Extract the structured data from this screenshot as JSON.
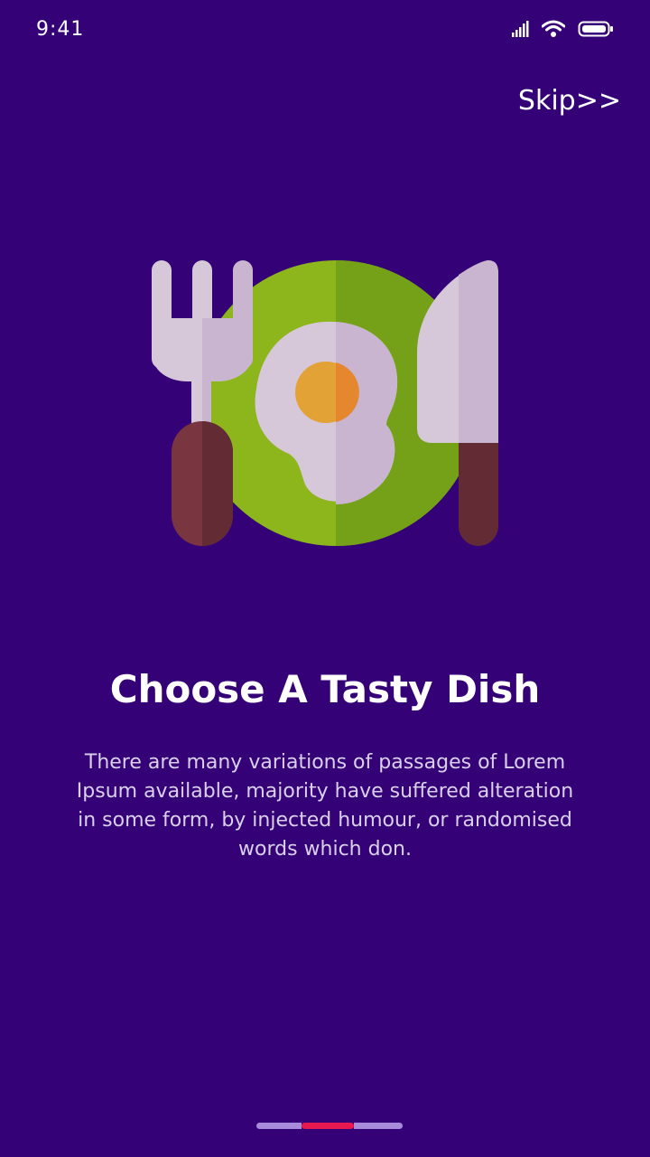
{
  "status_bar": {
    "time": "9:41",
    "icons": [
      "signal-icon",
      "wifi-icon",
      "battery-icon"
    ]
  },
  "header": {
    "skip_label": "Skip>>"
  },
  "onboarding": {
    "illustration": "plate-fork-knife-egg-icon",
    "title": "Choose A Tasty Dish",
    "description": "There are many variations of passages of Lorem Ipsum available,  majority have suffered alteration in some form, by injected humour, or randomised words which don."
  },
  "pager": {
    "total_pages": 3,
    "active_page": 2
  },
  "colors": {
    "background": "#340276",
    "accent": "#e8194e",
    "pager_inactive": "#a98bdb",
    "plate": "#8cb61c",
    "utensil": "#d6c7d9",
    "handle": "#7a3640",
    "yolk": "#e3a236"
  }
}
